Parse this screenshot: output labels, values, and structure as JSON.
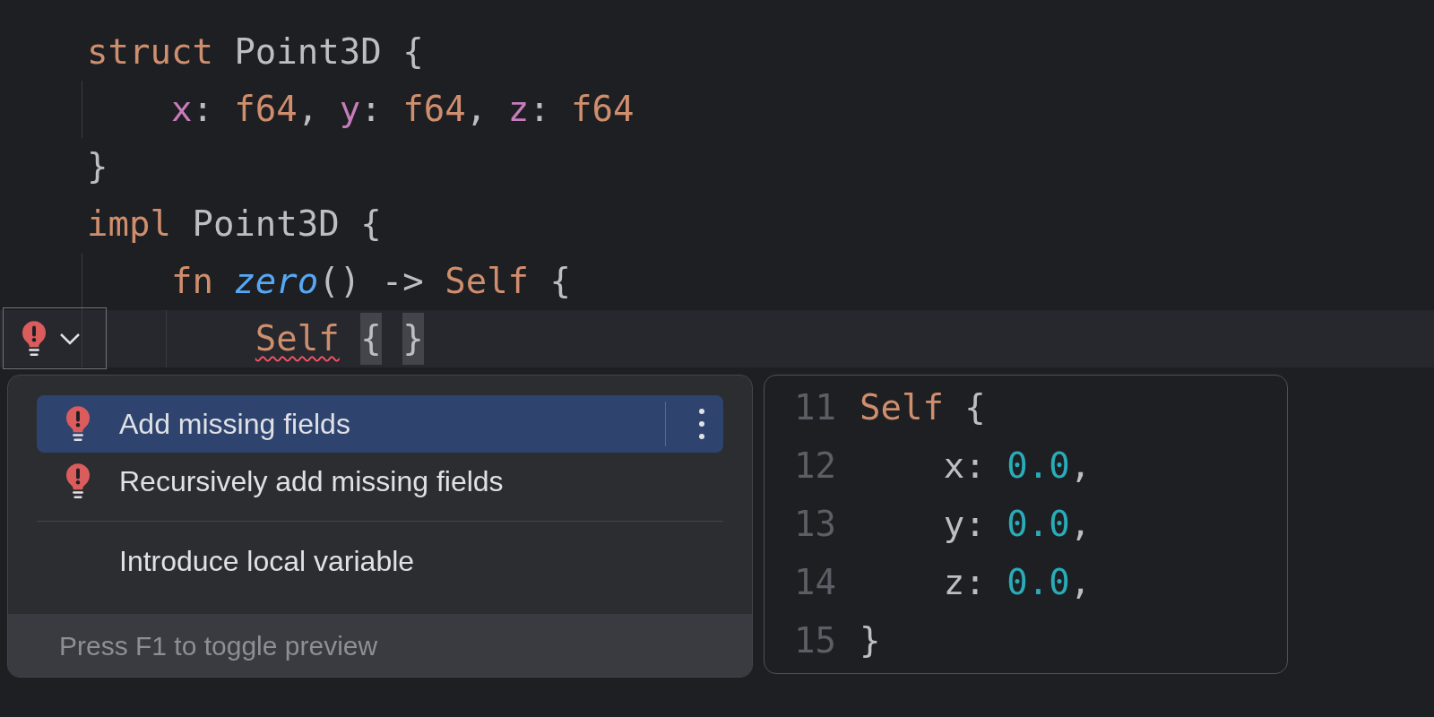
{
  "editor": {
    "lines": [
      {
        "tokens": [
          {
            "text": "struct ",
            "kind": "keyword"
          },
          {
            "text": "Point3D {",
            "kind": "plain"
          }
        ],
        "current": false,
        "children": [
          {
            "tokens": [
              {
                "text": "x",
                "kind": "field"
              },
              {
                "text": ": ",
                "kind": "plain"
              },
              {
                "text": "f64",
                "kind": "keyword"
              },
              {
                "text": ", ",
                "kind": "plain"
              },
              {
                "text": "y",
                "kind": "field"
              },
              {
                "text": ": ",
                "kind": "plain"
              },
              {
                "text": "f64",
                "kind": "keyword"
              },
              {
                "text": ", ",
                "kind": "plain"
              },
              {
                "text": "z",
                "kind": "field"
              },
              {
                "text": ": ",
                "kind": "plain"
              },
              {
                "text": "f64",
                "kind": "keyword"
              }
            ],
            "current": false
          }
        ]
      },
      {
        "tokens": [
          {
            "text": "}",
            "kind": "plain"
          }
        ],
        "current": false
      },
      {
        "tokens": [
          {
            "text": "impl ",
            "kind": "keyword"
          },
          {
            "text": "Point3D {",
            "kind": "plain"
          }
        ],
        "current": false,
        "children": [
          {
            "tokens": [
              {
                "text": "fn ",
                "kind": "keyword"
              },
              {
                "text": "zero",
                "kind": "function"
              },
              {
                "text": "() -> ",
                "kind": "plain"
              },
              {
                "text": "Self",
                "kind": "keyword"
              },
              {
                "text": " {",
                "kind": "plain"
              }
            ],
            "current": false,
            "children": [
              {
                "tokens": [
                  {
                    "text": "Self",
                    "kind": "keyword",
                    "error": true
                  },
                  {
                    "text": "{",
                    "kind": "brace",
                    "matched": true
                  },
                  {
                    "text": "}",
                    "kind": "brace",
                    "matched": true
                  }
                ],
                "current": true
              }
            ]
          }
        ]
      }
    ]
  },
  "intention_menu": {
    "groups": [
      [
        {
          "label": "Add missing fields",
          "kind": "quickfix",
          "selected": true
        },
        {
          "label": "Recursively add missing fields",
          "kind": "quickfix",
          "selected": false
        }
      ],
      [
        {
          "label": "Introduce local variable",
          "kind": "refactoring",
          "selected": false
        }
      ]
    ],
    "footer": "Press F1 to toggle preview"
  },
  "preview": {
    "lines": [
      {
        "number": "11",
        "tokens": [
          {
            "text": "Self",
            "kind": "keyword"
          },
          {
            "text": " {",
            "kind": "plain"
          }
        ],
        "children": [
          {
            "number": "12",
            "tokens": [
              {
                "text": "x: ",
                "kind": "plain"
              },
              {
                "text": "0.0",
                "kind": "number"
              },
              {
                "text": ",",
                "kind": "plain"
              }
            ]
          },
          {
            "number": "13",
            "tokens": [
              {
                "text": "y: ",
                "kind": "plain"
              },
              {
                "text": "0.0",
                "kind": "number"
              },
              {
                "text": ",",
                "kind": "plain"
              }
            ]
          },
          {
            "number": "14",
            "tokens": [
              {
                "text": "z: ",
                "kind": "plain"
              },
              {
                "text": "0.0",
                "kind": "number"
              },
              {
                "text": ",",
                "kind": "plain"
              }
            ]
          }
        ]
      },
      {
        "number": "15",
        "tokens": [
          {
            "text": "}",
            "kind": "plain"
          }
        ]
      }
    ]
  }
}
